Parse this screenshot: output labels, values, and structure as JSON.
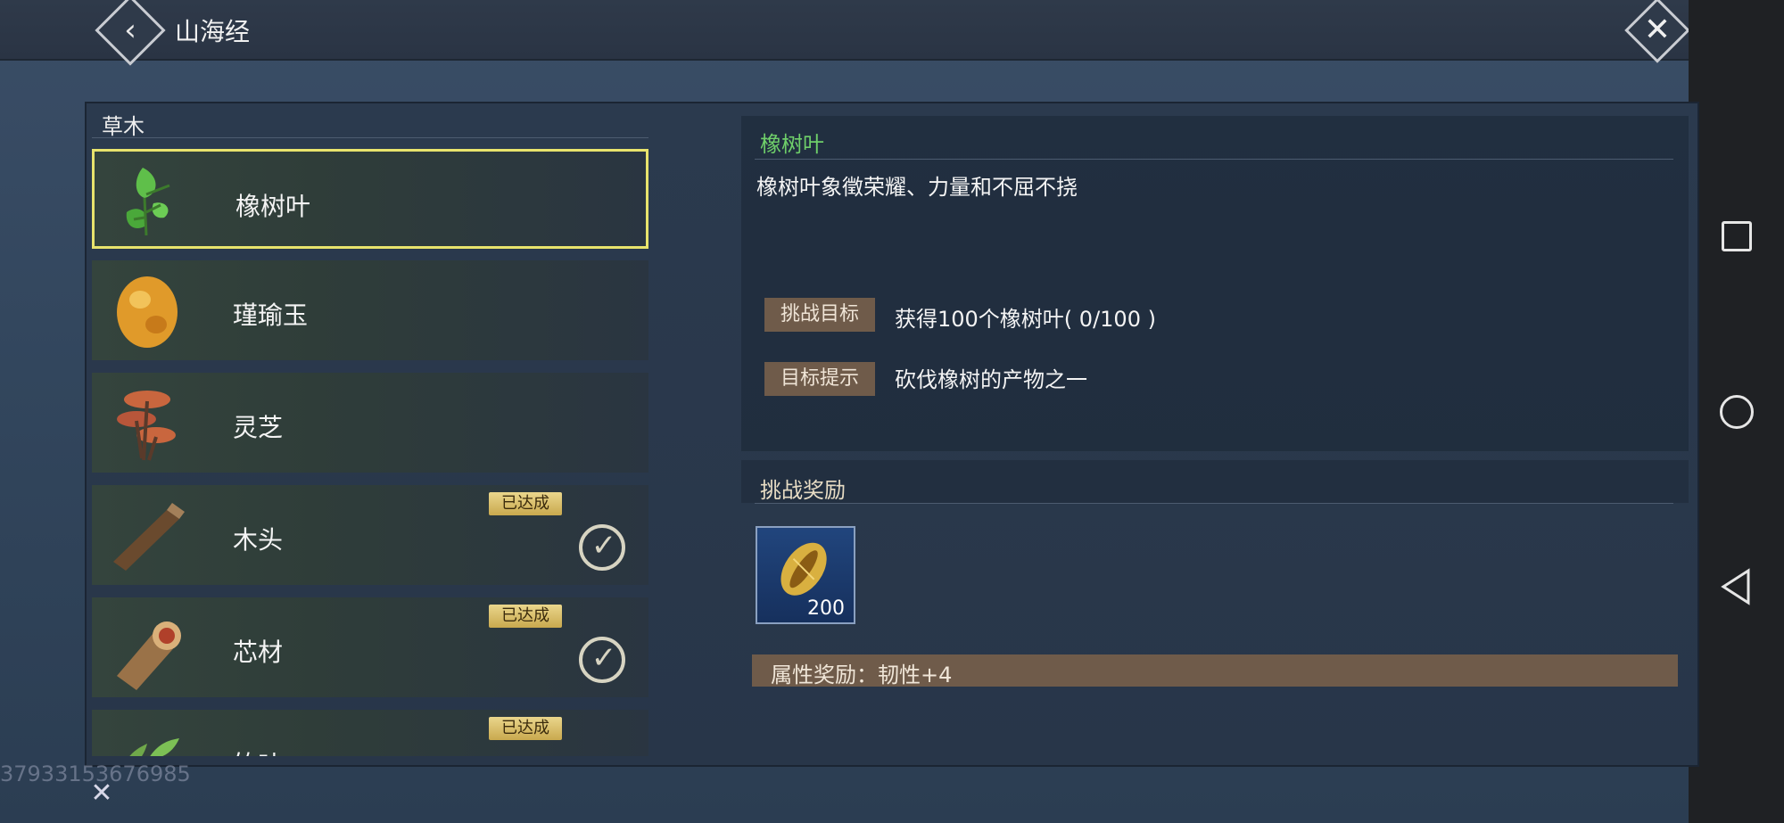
{
  "header": {
    "title": "山海经"
  },
  "list": {
    "section_label": "草木",
    "items": [
      {
        "name": "橡树叶",
        "icon": "oak-leaf-icon",
        "selected": true,
        "badge": ""
      },
      {
        "name": "瑾瑜玉",
        "icon": "jade-icon",
        "selected": false,
        "badge": ""
      },
      {
        "name": "灵芝",
        "icon": "lingzhi-icon",
        "selected": false,
        "badge": ""
      },
      {
        "name": "木头",
        "icon": "wood-log-icon",
        "selected": false,
        "badge": "已达成"
      },
      {
        "name": "芯材",
        "icon": "heartwood-icon",
        "selected": false,
        "badge": "已达成"
      },
      {
        "name": "竹叶",
        "icon": "bamboo-leaf-icon",
        "selected": false,
        "badge": "已达成"
      }
    ]
  },
  "detail": {
    "title": "橡树叶",
    "description": "橡树叶象徵荣耀、力量和不屈不挠",
    "goal_label": "挑战目标",
    "goal_value": "获得100个橡树叶( 0/100 )",
    "hint_label": "目标提示",
    "hint_value": "砍伐橡树的产物之一"
  },
  "reward": {
    "title": "挑战奖励",
    "item_icon": "golden-seed-icon",
    "item_count": "200",
    "attribute": "属性奖励：韧性+4"
  },
  "watermark": "37933153676985",
  "colors": {
    "selected_border": "#e8e36c",
    "title_green": "#6fcf6a",
    "label_bg": "#6f5b4a",
    "badge_gold": "#d9bf66"
  }
}
